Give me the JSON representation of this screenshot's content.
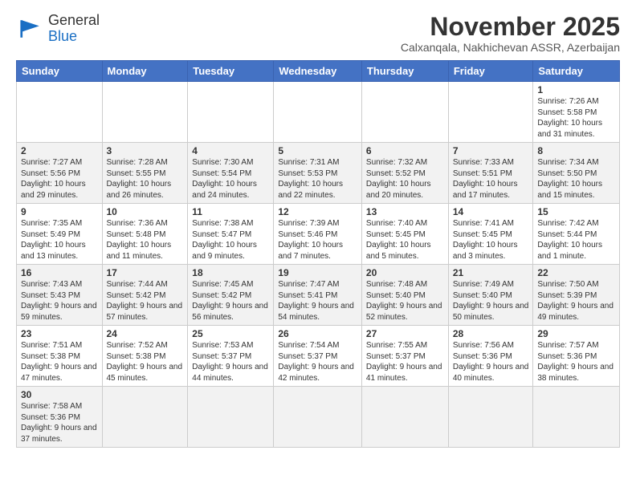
{
  "header": {
    "logo_line1": "General",
    "logo_line2": "Blue",
    "month_title": "November 2025",
    "subtitle": "Calxanqala, Nakhichevan ASSR, Azerbaijan"
  },
  "weekdays": [
    "Sunday",
    "Monday",
    "Tuesday",
    "Wednesday",
    "Thursday",
    "Friday",
    "Saturday"
  ],
  "weeks": [
    [
      {
        "day": "",
        "info": ""
      },
      {
        "day": "",
        "info": ""
      },
      {
        "day": "",
        "info": ""
      },
      {
        "day": "",
        "info": ""
      },
      {
        "day": "",
        "info": ""
      },
      {
        "day": "",
        "info": ""
      },
      {
        "day": "1",
        "info": "Sunrise: 7:26 AM\nSunset: 5:58 PM\nDaylight: 10 hours and 31 minutes."
      }
    ],
    [
      {
        "day": "2",
        "info": "Sunrise: 7:27 AM\nSunset: 5:56 PM\nDaylight: 10 hours and 29 minutes."
      },
      {
        "day": "3",
        "info": "Sunrise: 7:28 AM\nSunset: 5:55 PM\nDaylight: 10 hours and 26 minutes."
      },
      {
        "day": "4",
        "info": "Sunrise: 7:30 AM\nSunset: 5:54 PM\nDaylight: 10 hours and 24 minutes."
      },
      {
        "day": "5",
        "info": "Sunrise: 7:31 AM\nSunset: 5:53 PM\nDaylight: 10 hours and 22 minutes."
      },
      {
        "day": "6",
        "info": "Sunrise: 7:32 AM\nSunset: 5:52 PM\nDaylight: 10 hours and 20 minutes."
      },
      {
        "day": "7",
        "info": "Sunrise: 7:33 AM\nSunset: 5:51 PM\nDaylight: 10 hours and 17 minutes."
      },
      {
        "day": "8",
        "info": "Sunrise: 7:34 AM\nSunset: 5:50 PM\nDaylight: 10 hours and 15 minutes."
      }
    ],
    [
      {
        "day": "9",
        "info": "Sunrise: 7:35 AM\nSunset: 5:49 PM\nDaylight: 10 hours and 13 minutes."
      },
      {
        "day": "10",
        "info": "Sunrise: 7:36 AM\nSunset: 5:48 PM\nDaylight: 10 hours and 11 minutes."
      },
      {
        "day": "11",
        "info": "Sunrise: 7:38 AM\nSunset: 5:47 PM\nDaylight: 10 hours and 9 minutes."
      },
      {
        "day": "12",
        "info": "Sunrise: 7:39 AM\nSunset: 5:46 PM\nDaylight: 10 hours and 7 minutes."
      },
      {
        "day": "13",
        "info": "Sunrise: 7:40 AM\nSunset: 5:45 PM\nDaylight: 10 hours and 5 minutes."
      },
      {
        "day": "14",
        "info": "Sunrise: 7:41 AM\nSunset: 5:45 PM\nDaylight: 10 hours and 3 minutes."
      },
      {
        "day": "15",
        "info": "Sunrise: 7:42 AM\nSunset: 5:44 PM\nDaylight: 10 hours and 1 minute."
      }
    ],
    [
      {
        "day": "16",
        "info": "Sunrise: 7:43 AM\nSunset: 5:43 PM\nDaylight: 9 hours and 59 minutes."
      },
      {
        "day": "17",
        "info": "Sunrise: 7:44 AM\nSunset: 5:42 PM\nDaylight: 9 hours and 57 minutes."
      },
      {
        "day": "18",
        "info": "Sunrise: 7:45 AM\nSunset: 5:42 PM\nDaylight: 9 hours and 56 minutes."
      },
      {
        "day": "19",
        "info": "Sunrise: 7:47 AM\nSunset: 5:41 PM\nDaylight: 9 hours and 54 minutes."
      },
      {
        "day": "20",
        "info": "Sunrise: 7:48 AM\nSunset: 5:40 PM\nDaylight: 9 hours and 52 minutes."
      },
      {
        "day": "21",
        "info": "Sunrise: 7:49 AM\nSunset: 5:40 PM\nDaylight: 9 hours and 50 minutes."
      },
      {
        "day": "22",
        "info": "Sunrise: 7:50 AM\nSunset: 5:39 PM\nDaylight: 9 hours and 49 minutes."
      }
    ],
    [
      {
        "day": "23",
        "info": "Sunrise: 7:51 AM\nSunset: 5:38 PM\nDaylight: 9 hours and 47 minutes."
      },
      {
        "day": "24",
        "info": "Sunrise: 7:52 AM\nSunset: 5:38 PM\nDaylight: 9 hours and 45 minutes."
      },
      {
        "day": "25",
        "info": "Sunrise: 7:53 AM\nSunset: 5:37 PM\nDaylight: 9 hours and 44 minutes."
      },
      {
        "day": "26",
        "info": "Sunrise: 7:54 AM\nSunset: 5:37 PM\nDaylight: 9 hours and 42 minutes."
      },
      {
        "day": "27",
        "info": "Sunrise: 7:55 AM\nSunset: 5:37 PM\nDaylight: 9 hours and 41 minutes."
      },
      {
        "day": "28",
        "info": "Sunrise: 7:56 AM\nSunset: 5:36 PM\nDaylight: 9 hours and 40 minutes."
      },
      {
        "day": "29",
        "info": "Sunrise: 7:57 AM\nSunset: 5:36 PM\nDaylight: 9 hours and 38 minutes."
      }
    ],
    [
      {
        "day": "30",
        "info": "Sunrise: 7:58 AM\nSunset: 5:36 PM\nDaylight: 9 hours and 37 minutes."
      },
      {
        "day": "",
        "info": ""
      },
      {
        "day": "",
        "info": ""
      },
      {
        "day": "",
        "info": ""
      },
      {
        "day": "",
        "info": ""
      },
      {
        "day": "",
        "info": ""
      },
      {
        "day": "",
        "info": ""
      }
    ]
  ]
}
